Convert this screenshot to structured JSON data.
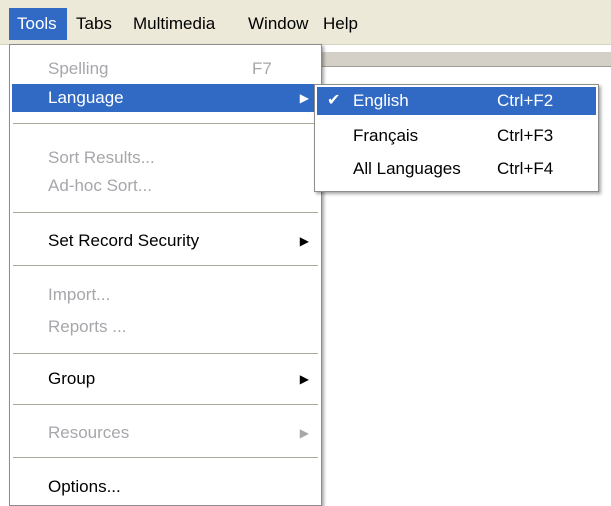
{
  "menubar": {
    "items": [
      {
        "label": "Tools"
      },
      {
        "label": "Tabs"
      },
      {
        "label": "Multimedia"
      },
      {
        "label": "Window"
      },
      {
        "label": "Help"
      }
    ]
  },
  "tools_menu": {
    "spelling": {
      "label": "Spelling",
      "shortcut": "F7"
    },
    "language": {
      "label": "Language"
    },
    "sort_results": {
      "label": "Sort Results..."
    },
    "adhoc_sort": {
      "label": "Ad-hoc Sort..."
    },
    "set_record_security": {
      "label": "Set Record Security"
    },
    "import": {
      "label": "Import..."
    },
    "reports": {
      "label": "Reports ..."
    },
    "group": {
      "label": "Group"
    },
    "resources": {
      "label": "Resources"
    },
    "options": {
      "label": "Options..."
    }
  },
  "language_menu": {
    "items": [
      {
        "label": "English",
        "shortcut": "Ctrl+F2",
        "checked": true
      },
      {
        "label": "Français",
        "shortcut": "Ctrl+F3"
      },
      {
        "label": "All Languages",
        "shortcut": "Ctrl+F4"
      }
    ]
  },
  "colors": {
    "highlight": "#316ac5",
    "menubar_bg": "#ece9d8",
    "disabled_text": "#a7a6aa"
  },
  "icons": {
    "submenu_arrow": "triangle-right-icon",
    "checkmark": "checkmark-icon"
  }
}
